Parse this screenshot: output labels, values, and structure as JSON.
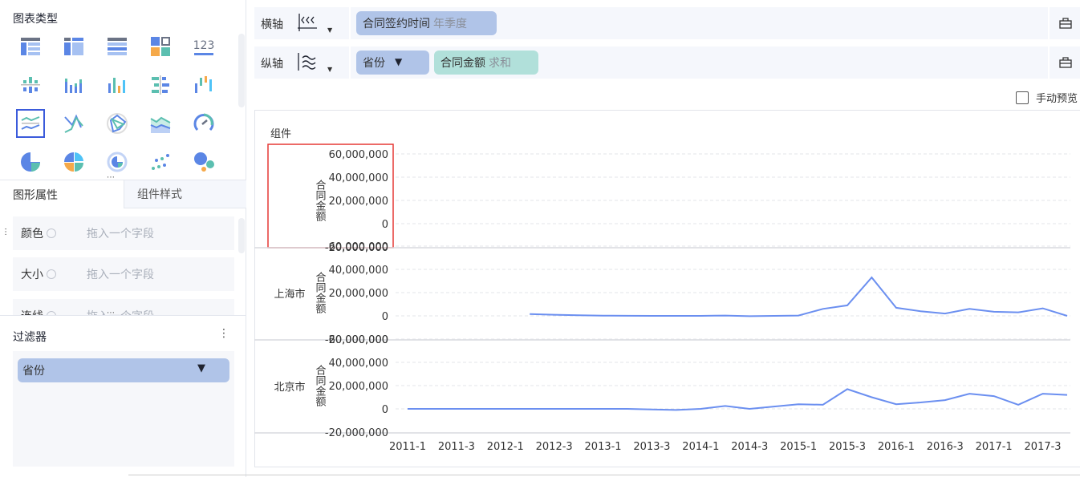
{
  "left": {
    "chart_type_title": "图表类型",
    "chart_types": [
      "table-icon",
      "cross-table-icon",
      "detail-table-icon",
      "kpi-card-icon",
      "number-icon",
      "grouped-bar-icon",
      "stacked-bar-icon",
      "multi-bar-icon",
      "horizontal-bar-icon",
      "waterfall-icon",
      "line-chart-icon",
      "parallel-line-icon",
      "radar-icon",
      "area-chart-icon",
      "gauge-icon",
      "pie-icon",
      "multi-pie-icon",
      "ring-pie-icon",
      "scatter-icon",
      "bubble-icon"
    ],
    "selected_chart_type": "line-chart-icon",
    "tabs": [
      "图形属性",
      "组件样式"
    ],
    "props": [
      {
        "label": "颜色",
        "placeholder": "拖入一个字段"
      },
      {
        "label": "大小",
        "placeholder": "拖入一个字段"
      },
      {
        "label": "连线",
        "placeholder": "拖入一个字段"
      }
    ],
    "filter_title": "过滤器",
    "filter_item": "省份"
  },
  "shelves": {
    "x_label": "横轴",
    "x_pills": [
      {
        "name": "合同签约时间",
        "sub": "年季度"
      }
    ],
    "y_label": "纵轴",
    "y_pills": [
      {
        "name": "省份",
        "sub": ""
      },
      {
        "name": "合同金额",
        "sub": "求和"
      }
    ],
    "manual_preview": "手动预览"
  },
  "chart_data": {
    "type": "line",
    "component_title": "组件",
    "ylabel": "合同金额",
    "yticks": [
      60000000,
      40000000,
      20000000,
      0,
      -20000000
    ],
    "ytick_labels": [
      "60,000,000",
      "40,000,000",
      "20,000,000",
      "0",
      "-20,000,000"
    ],
    "ylim": [
      -20000000,
      60000000
    ],
    "x": [
      "2011-1",
      "2011-2",
      "2011-3",
      "2011-4",
      "2012-1",
      "2012-2",
      "2012-3",
      "2012-4",
      "2013-1",
      "2013-2",
      "2013-3",
      "2013-4",
      "2014-1",
      "2014-2",
      "2014-3",
      "2014-4",
      "2015-1",
      "2015-2",
      "2015-3",
      "2015-4",
      "2016-1",
      "2016-2",
      "2016-3",
      "2016-4",
      "2017-1",
      "2017-2",
      "2017-3",
      "2017-4"
    ],
    "xtick_labels": [
      "2011-1",
      "2011-3",
      "2012-1",
      "2012-3",
      "2013-1",
      "2013-3",
      "2014-1",
      "2014-3",
      "2015-1",
      "2015-3",
      "2016-1",
      "2016-3",
      "2017-1",
      "2017-3"
    ],
    "line_color": "#6b8ff0",
    "grid": true,
    "panels": [
      {
        "label": "",
        "values": []
      },
      {
        "label": "上海市",
        "values": [
          null,
          null,
          null,
          null,
          null,
          1500000,
          1000000,
          500000,
          200000,
          100000,
          0,
          0,
          0,
          300000,
          -300000,
          0,
          300000,
          6000000,
          9000000,
          33000000,
          7000000,
          4000000,
          2000000,
          6000000,
          3500000,
          3000000,
          6500000,
          0
        ]
      },
      {
        "label": "北京市",
        "values": [
          0,
          0,
          0,
          0,
          0,
          0,
          0,
          0,
          0,
          0,
          -500000,
          -1000000,
          0,
          2500000,
          0,
          2000000,
          4000000,
          3500000,
          17000000,
          10000000,
          4000000,
          5500000,
          7500000,
          13000000,
          11000000,
          3500000,
          13000000,
          12000000
        ]
      }
    ]
  }
}
